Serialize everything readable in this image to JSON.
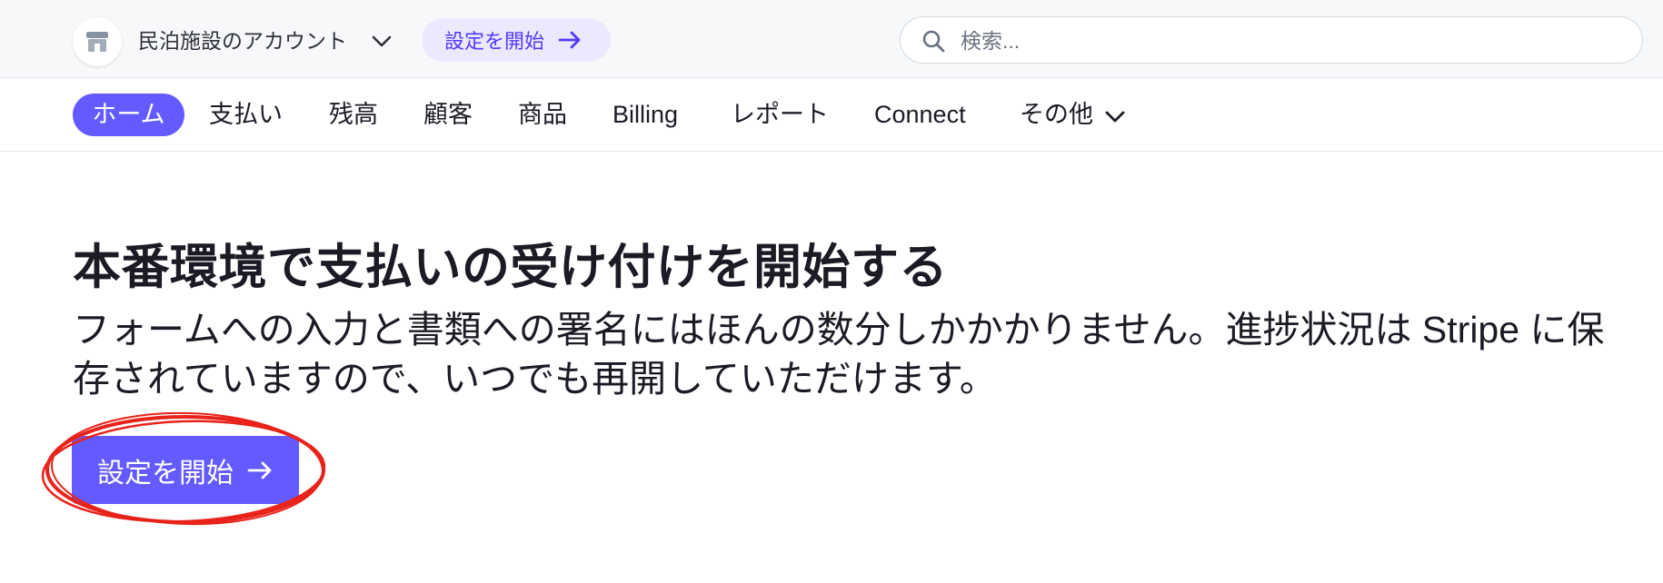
{
  "header": {
    "account_name": "民泊施設のアカウント",
    "account_icon": "store-icon",
    "setup_label": "設定を開始",
    "search": {
      "placeholder": "検索..."
    }
  },
  "nav": {
    "items": [
      {
        "label": "ホーム",
        "active": true
      },
      {
        "label": "支払い"
      },
      {
        "label": "残高"
      },
      {
        "label": "顧客"
      },
      {
        "label": "商品"
      },
      {
        "label": "Billing"
      },
      {
        "label": "レポート"
      },
      {
        "label": "Connect"
      },
      {
        "label": "その他"
      }
    ]
  },
  "main": {
    "headline": "本番環境で支払いの受け付けを開始する",
    "subtext": "フォームへの入力と書類への署名にはほんの数分しかかかりません。進捗状況は Stripe に保存されていますので、いつでも再開していただけます。",
    "cta_label": "設定を開始"
  },
  "colors": {
    "accent": "#635bff",
    "pill_bg": "#ece9ff",
    "pill_text": "#533afd",
    "annotation": "#e8231a",
    "topbar_bg": "#f6f8fa"
  }
}
